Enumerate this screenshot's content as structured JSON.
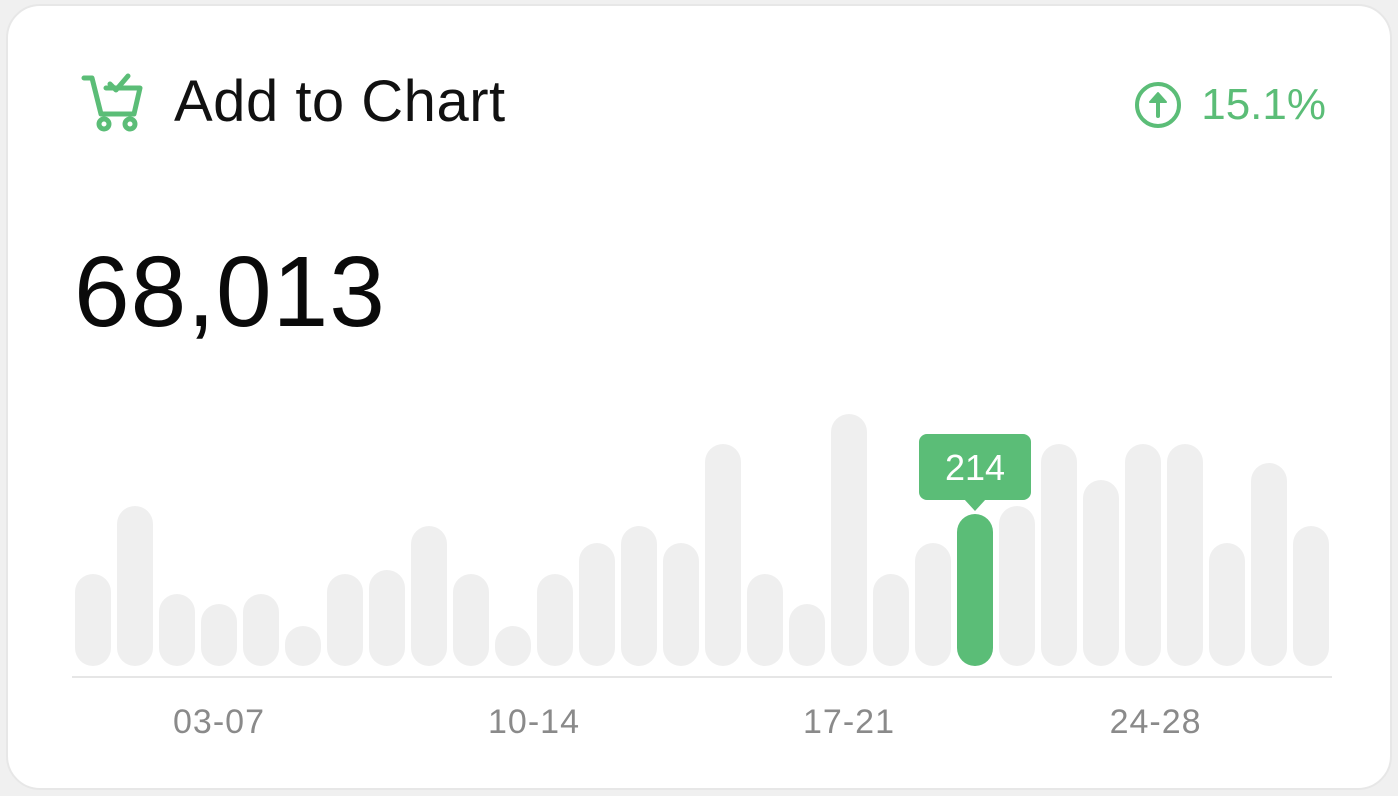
{
  "card": {
    "title": "Add to Chart",
    "total": "68,013",
    "trend_value": "15.1%",
    "title_icon": "shopping-cart-check-icon",
    "trend_icon": "arrow-up-circle-icon"
  },
  "colors": {
    "accent": "#5bbd77",
    "bar": "#efefef",
    "axis_text": "#8a8a8a",
    "axis_line": "#e6e6e6"
  },
  "chart_data": {
    "type": "bar",
    "x_tick_labels": [
      "03-07",
      "10-14",
      "17-21",
      "24-28"
    ],
    "values": [
      92,
      160,
      72,
      62,
      72,
      40,
      92,
      96,
      140,
      92,
      40,
      92,
      123,
      140,
      123,
      222,
      92,
      62,
      252,
      92,
      123,
      152,
      160,
      222,
      186,
      222,
      222,
      123,
      203,
      140
    ],
    "highlight_index": 21,
    "highlight_label": "214",
    "ylim": [
      0,
      260
    ],
    "grid": false
  }
}
